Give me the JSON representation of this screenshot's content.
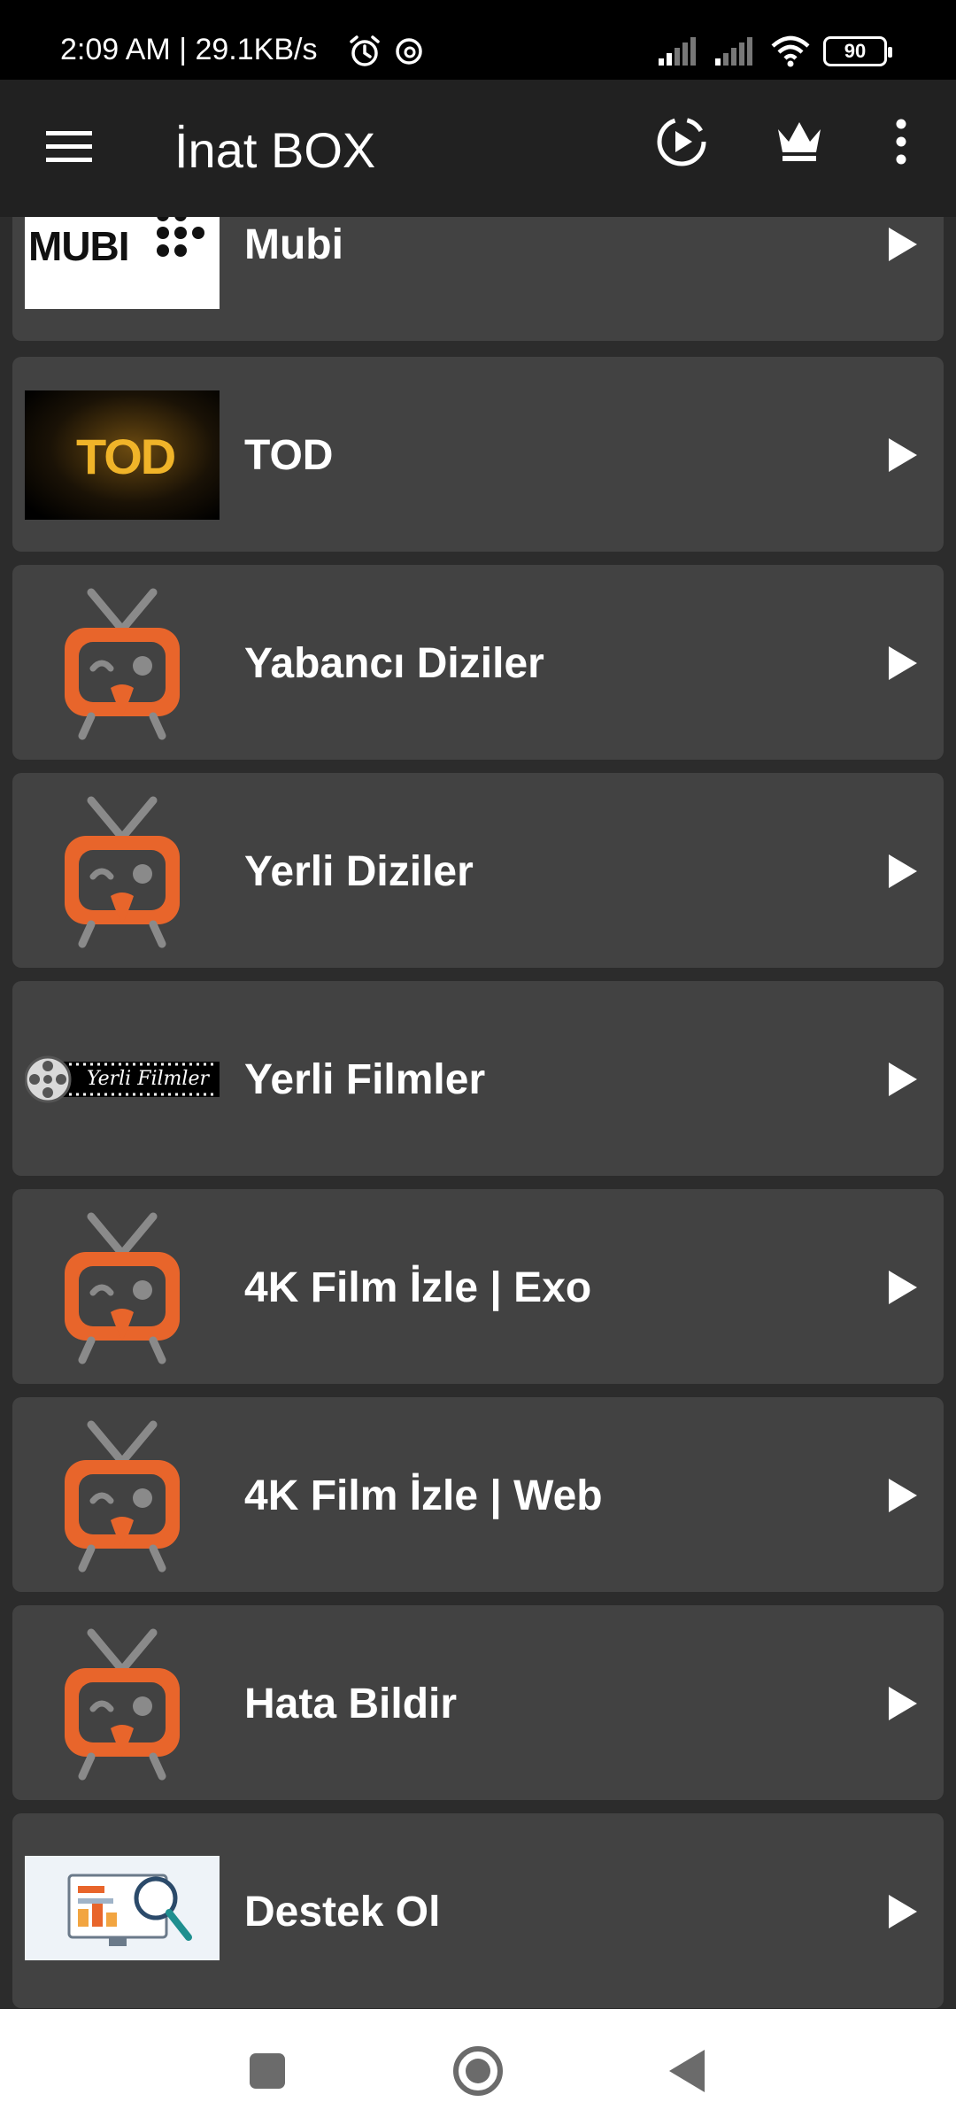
{
  "status_bar": {
    "time_net": "2:09 AM | 29.1KB/s",
    "battery": "90",
    "icons": [
      "alarm-icon",
      "threads-icon",
      "signal-icon",
      "signal-icon",
      "wifi-icon",
      "battery-icon"
    ]
  },
  "app_bar": {
    "title": "İnat BOX",
    "icons": [
      "menu-icon",
      "playback-icon",
      "crown-icon",
      "more-vert-icon"
    ]
  },
  "items": [
    {
      "label": "Mubi",
      "thumb": "mubi-logo",
      "thumb_text": "MUBI"
    },
    {
      "label": "TOD",
      "thumb": "tod-logo",
      "thumb_text": "TOD"
    },
    {
      "label": "Yabancı Diziler",
      "thumb": "tv-mascot-icon"
    },
    {
      "label": "Yerli Diziler",
      "thumb": "tv-mascot-icon"
    },
    {
      "label": "Yerli Filmler",
      "thumb": "yerli-filmler-banner",
      "thumb_text": "Yerli Filmler"
    },
    {
      "label": "4K Film İzle | Exo",
      "thumb": "tv-mascot-icon"
    },
    {
      "label": "4K Film İzle | Web",
      "thumb": "tv-mascot-icon"
    },
    {
      "label": "Hata Bildir",
      "thumb": "tv-mascot-icon"
    },
    {
      "label": "Destek Ol",
      "thumb": "support-illustration"
    }
  ],
  "nav_bar": {
    "icons": [
      "recents-icon",
      "home-icon",
      "back-icon"
    ]
  },
  "colors": {
    "card": "#424242",
    "background": "#2c2c2c",
    "app_bar": "#212121",
    "mascot_orange": "#e8652b",
    "mascot_grey": "#8a8a8a"
  }
}
